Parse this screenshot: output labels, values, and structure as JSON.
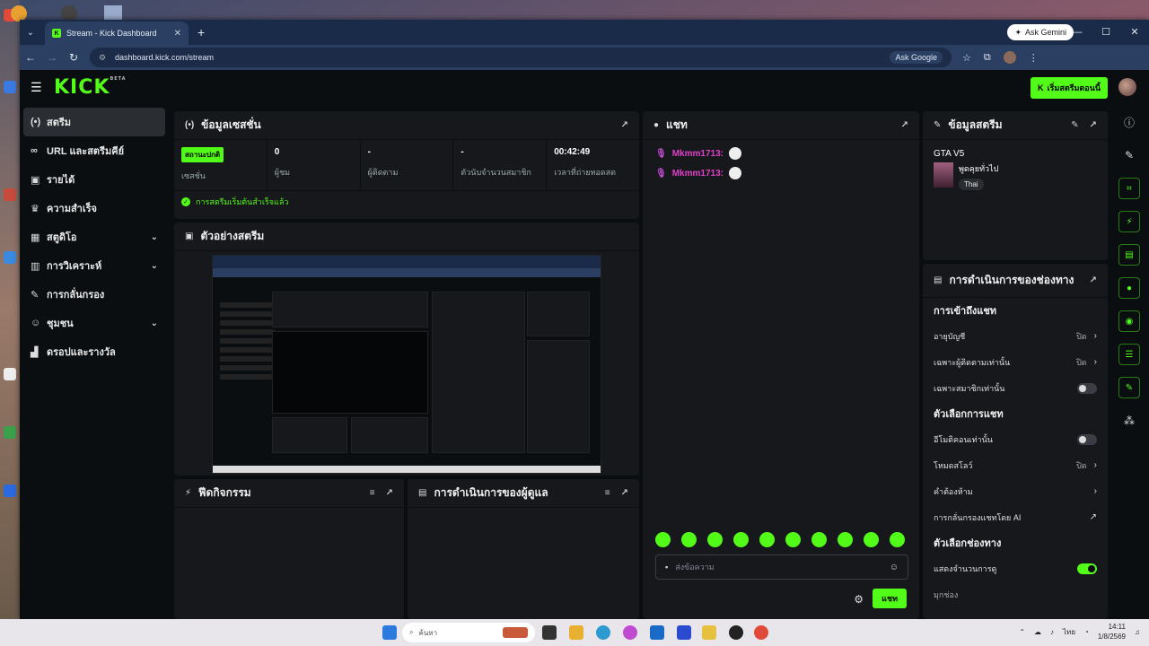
{
  "browser": {
    "tab_title": "Stream - Kick Dashboard",
    "url": "dashboard.kick.com/stream",
    "ask_gemini": "Ask Gemini",
    "ask_google": "Ask Google"
  },
  "header": {
    "logo": "KICK",
    "logo_badge": "BETA",
    "go_live": "เริ่มสตรีมตอนนี้"
  },
  "sidebar": {
    "items": [
      {
        "label": "สตรีม",
        "icon": "broadcast-icon"
      },
      {
        "label": "URL และสตรีมคีย์",
        "icon": "link-icon"
      },
      {
        "label": "รายได้",
        "icon": "dollar-icon"
      },
      {
        "label": "ความสำเร็จ",
        "icon": "trophy-icon"
      },
      {
        "label": "สตูดิโอ",
        "icon": "studio-icon"
      },
      {
        "label": "การวิเคราะห์",
        "icon": "analytics-icon"
      },
      {
        "label": "การกลั่นกรอง",
        "icon": "wrench-icon"
      },
      {
        "label": "ชุมชน",
        "icon": "people-icon"
      },
      {
        "label": "ดรอปและรางวัล",
        "icon": "gift-icon"
      }
    ]
  },
  "session": {
    "title": "ข้อมูลเซสชั่น",
    "status_badge": "สถานะปกติ",
    "status_label": "เซสชั่น",
    "viewers_value": "0",
    "viewers_label": "ผู้ชม",
    "followers_value": "-",
    "followers_label": "ผู้ติดตาม",
    "subs_value": "-",
    "subs_label": "ตัวนับจำนวนสมาชิก",
    "duration_value": "00:42:49",
    "duration_label": "เวลาที่ถ่ายทอดสด",
    "success_msg": "การสตรีมเริ่มต้นสำเร็จแล้ว"
  },
  "preview": {
    "title": "ตัวอย่างสตรีม"
  },
  "activity": {
    "title": "ฟีดกิจกรรม"
  },
  "mod_actions": {
    "title": "การดำเนินการของผู้ดูแล"
  },
  "chat": {
    "title": "แชท",
    "messages": [
      {
        "user": "Mkmm1713:"
      },
      {
        "user": "Mkmm1713:"
      }
    ],
    "input_placeholder": "ส่งข้อความ",
    "send_label": "แชท"
  },
  "stream_info": {
    "title": "ข้อมูลสตรีม",
    "game": "GTA V5",
    "category": "พูดคุยทั่วไป",
    "language": "Thai"
  },
  "channel_actions": {
    "title": "การดำเนินการของช่องทาง",
    "sec1": "การเข้าถึงแชท",
    "rows1": [
      {
        "label": "อายุบัญชี",
        "val": "ปิด"
      },
      {
        "label": "เฉพาะผู้ติดตามเท่านั้น",
        "val": "ปิด"
      },
      {
        "label": "เฉพาะสมาชิกเท่านั้น",
        "val": ""
      }
    ],
    "sec2": "ตัวเลือกการแชท",
    "rows2": [
      {
        "label": "อีโมติคอนเท่านั้น",
        "val": ""
      },
      {
        "label": "โหมดสโลว์",
        "val": "ปิด"
      },
      {
        "label": "คำต้องห้าม",
        "val": ""
      },
      {
        "label": "การกลั่นกรองแชทโดย AI",
        "val": ""
      }
    ],
    "sec3": "ตัวเลือกช่องทาง",
    "rows3": [
      {
        "label": "แสดงจำนวนการดู"
      },
      {
        "label": "มุกช่อง"
      }
    ]
  },
  "taskbar": {
    "search": "ค้นหา",
    "lang": "ไทย",
    "time": "14:11",
    "date": "1/8/2569"
  }
}
